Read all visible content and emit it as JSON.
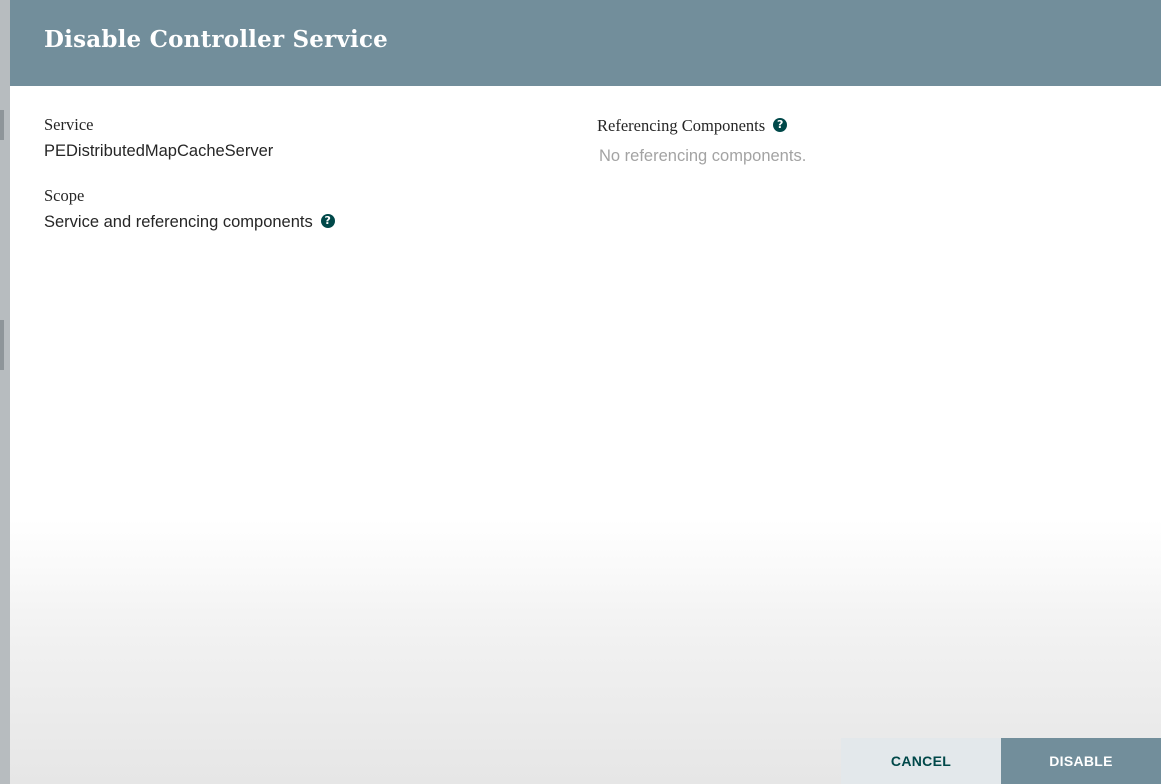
{
  "dialog": {
    "title": "Disable Controller Service"
  },
  "service": {
    "label": "Service",
    "value": "PEDistributedMapCacheServer"
  },
  "scope": {
    "label": "Scope",
    "value": "Service and referencing components",
    "help_icon": "question-circle-icon"
  },
  "referencing": {
    "label": "Referencing Components",
    "help_icon": "question-circle-icon",
    "empty_text": "No referencing components."
  },
  "footer": {
    "cancel_label": "CANCEL",
    "disable_label": "DISABLE"
  },
  "colors": {
    "header": "#728e9b",
    "accent": "#004849",
    "cancel_bg": "#e3e8eb"
  }
}
